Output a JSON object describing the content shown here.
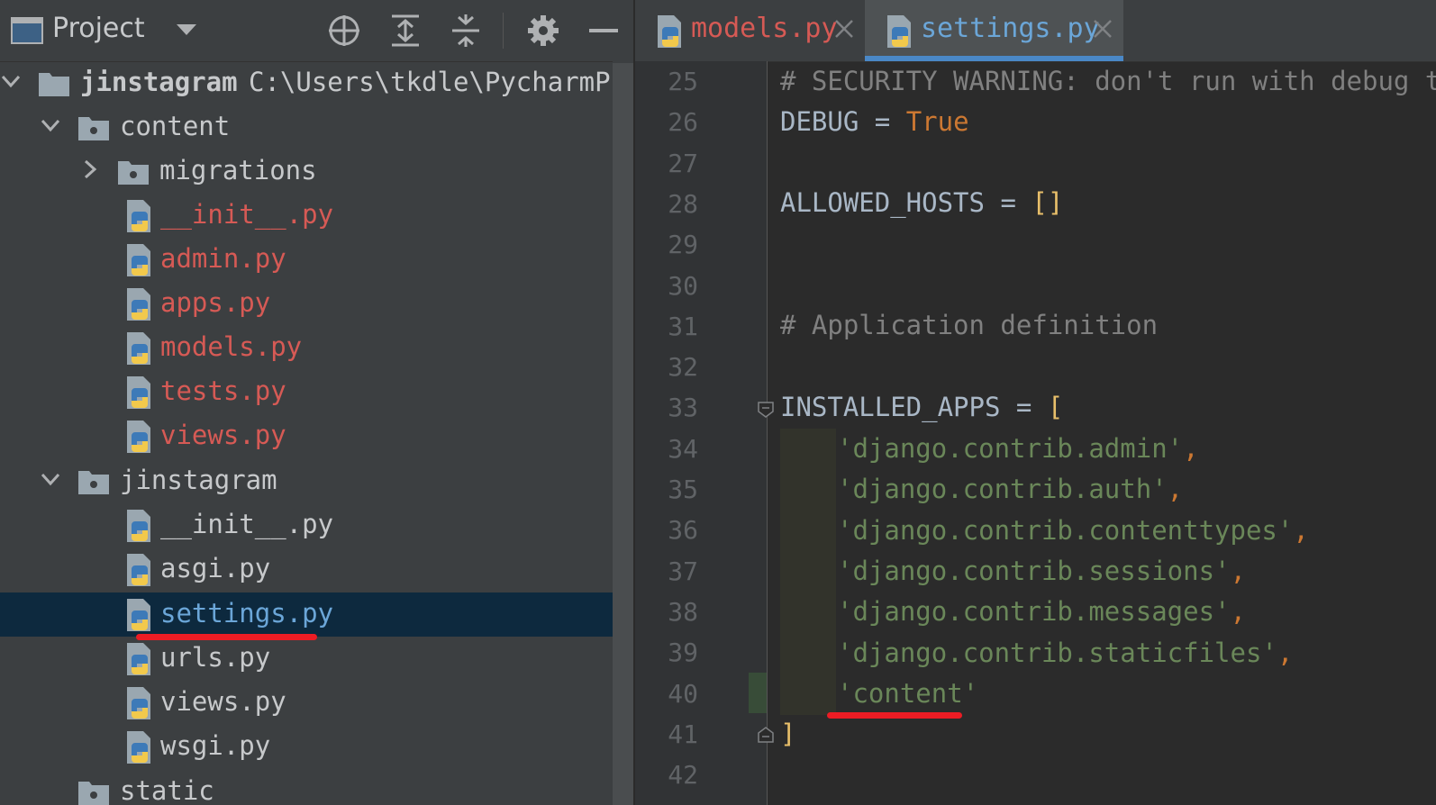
{
  "project_panel": {
    "title": "Project",
    "tree": [
      {
        "label": "jinstagram",
        "path": "C:\\Users\\tkdle\\PycharmProje",
        "type": "root"
      },
      {
        "label": "content",
        "type": "package"
      },
      {
        "label": "migrations",
        "type": "package"
      },
      {
        "label": "__init__.py",
        "type": "file",
        "state": "new"
      },
      {
        "label": "admin.py",
        "type": "file",
        "state": "new"
      },
      {
        "label": "apps.py",
        "type": "file",
        "state": "new"
      },
      {
        "label": "models.py",
        "type": "file",
        "state": "new"
      },
      {
        "label": "tests.py",
        "type": "file",
        "state": "new"
      },
      {
        "label": "views.py",
        "type": "file",
        "state": "new"
      },
      {
        "label": "jinstagram",
        "type": "package"
      },
      {
        "label": "__init__.py",
        "type": "file"
      },
      {
        "label": "asgi.py",
        "type": "file"
      },
      {
        "label": "settings.py",
        "type": "file",
        "state": "selected"
      },
      {
        "label": "urls.py",
        "type": "file"
      },
      {
        "label": "views.py",
        "type": "file"
      },
      {
        "label": "wsgi.py",
        "type": "file"
      },
      {
        "label": "static",
        "type": "package"
      }
    ]
  },
  "tabs": [
    {
      "label": "models.py",
      "active": false
    },
    {
      "label": "settings.py",
      "active": true
    }
  ],
  "editor": {
    "line_numbers": [
      "25",
      "26",
      "27",
      "28",
      "29",
      "30",
      "31",
      "32",
      "33",
      "34",
      "35",
      "36",
      "37",
      "38",
      "39",
      "40",
      "41",
      "42"
    ],
    "lines": {
      "l25": "# SECURITY WARNING: don't run with debug turn",
      "l26_var": "DEBUG",
      "l26_eq": " = ",
      "l26_val": "True",
      "l28_var": "ALLOWED_HOSTS",
      "l28_eq": " = ",
      "l28_val": "[]",
      "l31": "# Application definition",
      "l33_var": "INSTALLED_APPS",
      "l33_eq": " = ",
      "l33_open": "[",
      "apps": [
        "'django.contrib.admin'",
        "'django.contrib.auth'",
        "'django.contrib.contenttypes'",
        "'django.contrib.sessions'",
        "'django.contrib.messages'",
        "'django.contrib.staticfiles'",
        "'content'"
      ],
      "comma": ",",
      "l41_close": "]"
    }
  },
  "colors": {
    "panel_bg": "#3c3f41",
    "editor_bg": "#2b2b2b",
    "new_file": "#d65a55",
    "selected_text": "#6ba6d8",
    "keyword": "#cc7832",
    "string": "#6a8759",
    "bracket": "#e8bf6a",
    "annotation": "#ec1c24"
  },
  "icons": {
    "project_view": "project-view-icon",
    "locate": "crosshair-icon",
    "expand": "expand-all-icon",
    "collapse": "collapse-all-icon",
    "settings": "gear-icon",
    "hide": "minimize-icon",
    "python_file": "python-file-icon",
    "folder": "folder-icon"
  }
}
